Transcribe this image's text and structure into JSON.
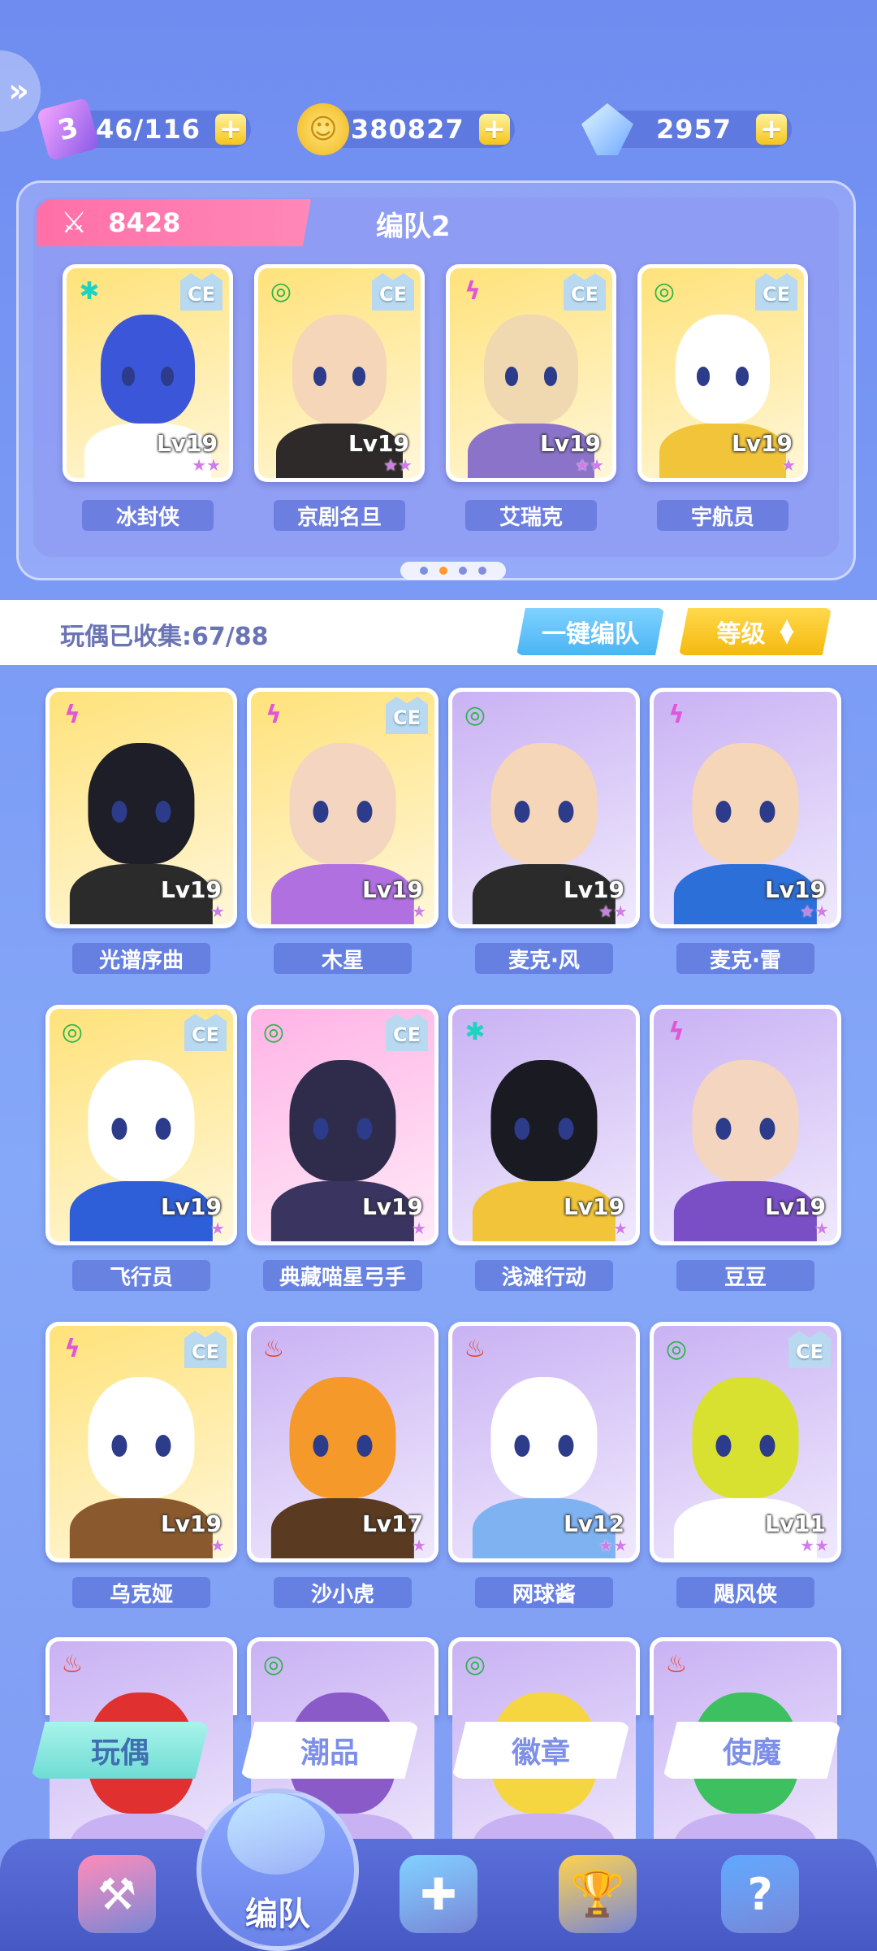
{
  "resources": {
    "stamina": {
      "value": "46/116",
      "icon": "stamina-ticket-icon",
      "color": "#c86bf0"
    },
    "coins": {
      "value": "380827",
      "icon": "coin-icon",
      "color": "#f6c633"
    },
    "gems": {
      "value": "2957",
      "icon": "crystal-icon",
      "color": "#9ad8ff"
    }
  },
  "team": {
    "power": "8428",
    "title": "编队2",
    "page_index": 1,
    "page_count": 4,
    "members": [
      {
        "name": "冰封侠",
        "level": "Lv19",
        "element": "✱",
        "element_color": "#1fd3c0",
        "ce": true,
        "stars": "★★",
        "bg": "#ffe27a",
        "head": "#3b56d8",
        "body": "#ffffff"
      },
      {
        "name": "京剧名旦",
        "level": "Lv19",
        "element": "◎",
        "element_color": "#2bb54a",
        "ce": true,
        "stars": "★★",
        "bg": "#ffe27a",
        "head": "#f6d6b8",
        "body": "#2e2a2a"
      },
      {
        "name": "艾瑞克",
        "level": "Lv19",
        "element": "ϟ",
        "element_color": "#e056d8",
        "ce": true,
        "stars": "★★",
        "bg": "#ffe27a",
        "head": "#f0d8b0",
        "body": "#8a73c8"
      },
      {
        "name": "宇航员",
        "level": "Lv19",
        "element": "◎",
        "element_color": "#2bb54a",
        "ce": true,
        "stars": "★",
        "bg": "#ffe27a",
        "head": "#ffffff",
        "body": "#f1c43a"
      }
    ]
  },
  "collection": {
    "label": "玩偶已收集:67/88",
    "quick_team_button": "一键编队",
    "sort_button": "等级"
  },
  "dolls": [
    {
      "name": "光谱序曲",
      "level": "Lv19",
      "element": "ϟ",
      "element_color": "#e056d8",
      "ce": false,
      "stars": "★",
      "bg": "#ffe27a",
      "head": "#1e1e28",
      "body": "#2b2b2b"
    },
    {
      "name": "木星",
      "level": "Lv19",
      "element": "ϟ",
      "element_color": "#e056d8",
      "ce": true,
      "stars": "★",
      "bg": "#ffe27a",
      "head": "#f4d5c0",
      "body": "#b070e0"
    },
    {
      "name": "麦克·风",
      "level": "Lv19",
      "element": "◎",
      "element_color": "#2bb54a",
      "ce": false,
      "stars": "★★",
      "bg": "#c9b2f4",
      "head": "#f6d6b8",
      "body": "#2b2b2b"
    },
    {
      "name": "麦克·雷",
      "level": "Lv19",
      "element": "ϟ",
      "element_color": "#e056d8",
      "ce": false,
      "stars": "★★",
      "bg": "#c9b2f4",
      "head": "#f6d6b8",
      "body": "#2c6fd8"
    },
    {
      "name": "飞行员",
      "level": "Lv19",
      "element": "◎",
      "element_color": "#2bb54a",
      "ce": true,
      "stars": "★",
      "bg": "#ffe27a",
      "head": "#ffffff",
      "body": "#2f5fd8"
    },
    {
      "name": "典藏喵星弓手",
      "level": "Lv19",
      "element": "◎",
      "element_color": "#2bb54a",
      "ce": true,
      "stars": "★",
      "bg": "#ffb3e6",
      "head": "#2f2b4a",
      "body": "#3a3460"
    },
    {
      "name": "浅滩行动",
      "level": "Lv19",
      "element": "✱",
      "element_color": "#1fd3c0",
      "ce": false,
      "stars": "★",
      "bg": "#c9b2f4",
      "head": "#1a1a22",
      "body": "#f1c43a"
    },
    {
      "name": "豆豆",
      "level": "Lv19",
      "element": "ϟ",
      "element_color": "#e056d8",
      "ce": false,
      "stars": "★",
      "bg": "#c9b2f4",
      "head": "#f4d5c0",
      "body": "#7a4ec4"
    },
    {
      "name": "乌克娅",
      "level": "Lv19",
      "element": "ϟ",
      "element_color": "#e056d8",
      "ce": true,
      "stars": "★",
      "bg": "#ffe27a",
      "head": "#ffffff",
      "body": "#8a5a2e"
    },
    {
      "name": "沙小虎",
      "level": "Lv17",
      "element": "♨",
      "element_color": "#e8412a",
      "ce": false,
      "stars": "★",
      "bg": "#c9b2f4",
      "head": "#f59a2a",
      "body": "#5a3a20"
    },
    {
      "name": "网球酱",
      "level": "Lv12",
      "element": "♨",
      "element_color": "#e8412a",
      "ce": false,
      "stars": "★★",
      "bg": "#c9b2f4",
      "head": "#ffffff",
      "body": "#7fb2f0"
    },
    {
      "name": "飓风侠",
      "level": "Lv11",
      "element": "◎",
      "element_color": "#2bb54a",
      "ce": true,
      "stars": "★★",
      "bg": "#c9b2f4",
      "head": "#d8e030",
      "body": "#ffffff"
    },
    {
      "name": "",
      "level": "",
      "element": "♨",
      "element_color": "#e8412a",
      "ce": false,
      "stars": "",
      "bg": "#c9b2f4",
      "head": "#e03030",
      "body": "#c9b2f4"
    },
    {
      "name": "",
      "level": "",
      "element": "◎",
      "element_color": "#2bb54a",
      "ce": false,
      "stars": "",
      "bg": "#c9b2f4",
      "head": "#8a5ac8",
      "body": "#c9b2f4"
    },
    {
      "name": "",
      "level": "",
      "element": "◎",
      "element_color": "#2bb54a",
      "ce": false,
      "stars": "",
      "bg": "#c9b2f4",
      "head": "#f6d640",
      "body": "#c9b2f4"
    },
    {
      "name": "",
      "level": "",
      "element": "♨",
      "element_color": "#e8412a",
      "ce": false,
      "stars": "",
      "bg": "#c9b2f4",
      "head": "#3cc060",
      "body": "#c9b2f4"
    }
  ],
  "categories": [
    {
      "label": "玩偶",
      "active": true
    },
    {
      "label": "潮品",
      "active": false
    },
    {
      "label": "徽章",
      "active": false
    },
    {
      "label": "使魔",
      "active": false
    }
  ],
  "bottom_nav": {
    "center_label": "编队",
    "items": [
      {
        "icon": "hammer-icon"
      },
      {
        "icon": "whistle-icon"
      },
      {
        "icon": "gamepad-icon"
      },
      {
        "icon": "trophy-icon"
      },
      {
        "icon": "mystery-machine-icon"
      }
    ]
  }
}
